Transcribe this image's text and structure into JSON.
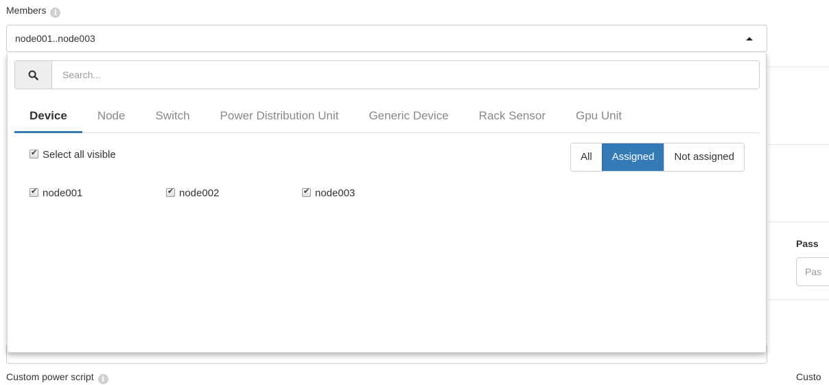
{
  "members": {
    "label": "Members",
    "selected_value": "node001..node003"
  },
  "dropdown": {
    "search_placeholder": "Search...",
    "tabs": [
      {
        "label": "Device",
        "active": true
      },
      {
        "label": "Node",
        "active": false
      },
      {
        "label": "Switch",
        "active": false
      },
      {
        "label": "Power Distribution Unit",
        "active": false
      },
      {
        "label": "Generic Device",
        "active": false
      },
      {
        "label": "Rack Sensor",
        "active": false
      },
      {
        "label": "Gpu Unit",
        "active": false
      }
    ],
    "select_all_label": "Select all visible",
    "select_all_checked": true,
    "filters": [
      {
        "label": "All",
        "active": false
      },
      {
        "label": "Assigned",
        "active": true
      },
      {
        "label": "Not assigned",
        "active": false
      }
    ],
    "items": [
      {
        "label": "node001",
        "checked": true
      },
      {
        "label": "node002",
        "checked": true
      },
      {
        "label": "node003",
        "checked": true
      }
    ]
  },
  "background": {
    "password_label": "Pass",
    "password_placeholder": "Pas",
    "custom_power_script_label": "Custom power script",
    "custom_right_label": "Custo"
  },
  "colors": {
    "accent": "#337ab7",
    "active_tab_text": "#333333",
    "inactive_tab_text": "#888888"
  },
  "icons": {
    "search": "search-icon",
    "info": "info-icon",
    "caret": "caret-up-icon"
  }
}
